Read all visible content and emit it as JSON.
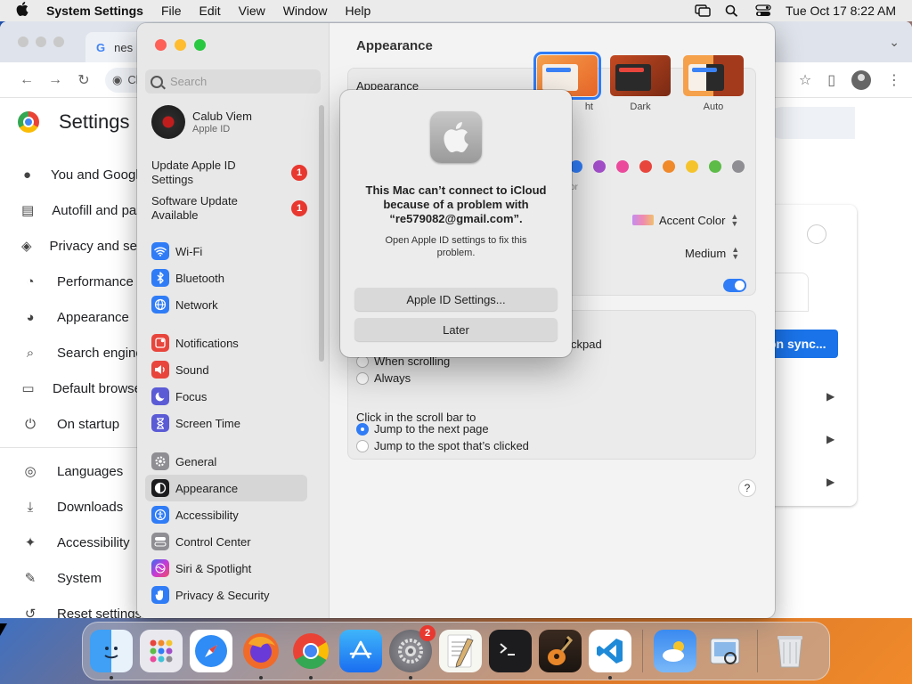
{
  "menubar": {
    "app_name": "System Settings",
    "menus": [
      "File",
      "Edit",
      "View",
      "Window",
      "Help"
    ],
    "datetime": "Tue Oct 17  8:22 AM"
  },
  "chrome": {
    "tab_title": "nes",
    "omnibox_text": "Ch",
    "settings_title": "Settings",
    "nav": [
      {
        "icon": "person-icon",
        "label": "You and Google"
      },
      {
        "icon": "clipboard-icon",
        "label": "Autofill and passwords"
      },
      {
        "icon": "shield-icon",
        "label": "Privacy and security"
      },
      {
        "icon": "speedometer-icon",
        "label": "Performance"
      },
      {
        "icon": "palette-icon",
        "label": "Appearance"
      },
      {
        "icon": "search-icon",
        "label": "Search engine"
      },
      {
        "icon": "browser-icon",
        "label": "Default browser"
      },
      {
        "icon": "power-icon",
        "label": "On startup"
      },
      {
        "icon": "globe-icon",
        "label": "Languages"
      },
      {
        "icon": "download-icon",
        "label": "Downloads"
      },
      {
        "icon": "accessibility-icon",
        "label": "Accessibility"
      },
      {
        "icon": "wrench-icon",
        "label": "System"
      },
      {
        "icon": "reset-icon",
        "label": "Reset settings"
      }
    ],
    "sync_button": "on sync..."
  },
  "system_settings": {
    "search_placeholder": "Search",
    "account_name": "Calub Viem",
    "account_sub": "Apple ID",
    "alerts": [
      {
        "label": "Update Apple ID Settings",
        "badge": "1"
      },
      {
        "label": "Software Update Available",
        "badge": "1"
      }
    ],
    "sidebar_groups": [
      [
        {
          "label": "Wi-Fi",
          "icon": "wifi-icon",
          "color": "#2f7cf6"
        },
        {
          "label": "Bluetooth",
          "icon": "bluetooth-icon",
          "color": "#2f7cf6"
        },
        {
          "label": "Network",
          "icon": "globe-icon",
          "color": "#2f7cf6"
        }
      ],
      [
        {
          "label": "Notifications",
          "icon": "bell-icon",
          "color": "#e8453c"
        },
        {
          "label": "Sound",
          "icon": "speaker-icon",
          "color": "#e8453c"
        },
        {
          "label": "Focus",
          "icon": "moon-icon",
          "color": "#5b5bd6"
        },
        {
          "label": "Screen Time",
          "icon": "hourglass-icon",
          "color": "#5b5bd6"
        }
      ],
      [
        {
          "label": "General",
          "icon": "gear-icon",
          "color": "#8e8e93"
        },
        {
          "label": "Appearance",
          "icon": "appearance-icon",
          "color": "#1c1c1e",
          "selected": true
        },
        {
          "label": "Accessibility",
          "icon": "accessibility-icon",
          "color": "#2f7cf6"
        },
        {
          "label": "Control Center",
          "icon": "control-center-icon",
          "color": "#8e8e93"
        },
        {
          "label": "Siri & Spotlight",
          "icon": "siri-icon",
          "color": "#b03ad8"
        },
        {
          "label": "Privacy & Security",
          "icon": "hand-icon",
          "color": "#2f7cf6"
        }
      ]
    ],
    "page_title": "Appearance",
    "appearance_label": "Appearance",
    "theme_options": [
      {
        "caption": "ht",
        "selected": true
      },
      {
        "caption": "Dark"
      },
      {
        "caption": "Auto"
      }
    ],
    "accent_colors": [
      "#2f7cf6",
      "#a24ec9",
      "#eb4a9c",
      "#e8453c",
      "#f0892a",
      "#f5c42c",
      "#5dbb47",
      "#8e8e93"
    ],
    "accent_fragment": "or",
    "highlight_value": "Accent Color",
    "sidebar_size_value": "Medium",
    "scroll_fragment": "ckpad",
    "scroll_options": [
      "When scrolling",
      "Always"
    ],
    "click_label": "Click in the scroll bar to",
    "click_options": [
      "Jump to the next page",
      "Jump to the spot that’s clicked"
    ],
    "help": "?"
  },
  "dialog": {
    "heading": "This Mac can’t connect to iCloud because of a problem with “re579082@gmail.com”.",
    "body": "Open Apple ID settings to fix this problem.",
    "primary_button": "Apple ID Settings...",
    "secondary_button": "Later"
  },
  "dock": {
    "settings_badge": "2",
    "apps": [
      "Finder",
      "Launchpad",
      "Safari",
      "Firefox",
      "Chrome",
      "App Store",
      "System Settings",
      "TextEdit",
      "Terminal",
      "GarageBand",
      "VS Code",
      "Weather",
      "Preview",
      "Trash"
    ]
  }
}
